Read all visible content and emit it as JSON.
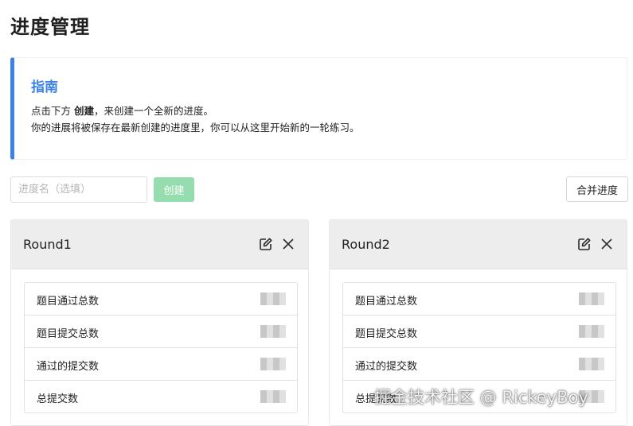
{
  "page": {
    "title": "进度管理"
  },
  "guide": {
    "title": "指南",
    "line1_prefix": "点击下方 ",
    "line1_bold": "创建",
    "line1_suffix": "，来创建一个全新的进度。",
    "line2": "你的进展将被保存在最新创建的进度里，你可以从这里开始新的一轮练习。"
  },
  "toolbar": {
    "name_placeholder": "进度名（选填）",
    "create_label": "创建",
    "merge_label": "合并进度"
  },
  "rounds": [
    {
      "name": "Round1",
      "stats": [
        {
          "label": "题目通过总数"
        },
        {
          "label": "题目提交总数"
        },
        {
          "label": "通过的提交数"
        },
        {
          "label": "总提交数"
        }
      ]
    },
    {
      "name": "Round2",
      "stats": [
        {
          "label": "题目通过总数"
        },
        {
          "label": "题目提交总数"
        },
        {
          "label": "通过的提交数"
        },
        {
          "label": "总提交数"
        }
      ]
    }
  ],
  "icons": {
    "edit": "edit-icon",
    "close": "close-icon"
  },
  "colors": {
    "accent": "#3b82e6",
    "create_button": "#95dcae"
  },
  "watermark": "掘金技术社区 @ RickeyBoy"
}
